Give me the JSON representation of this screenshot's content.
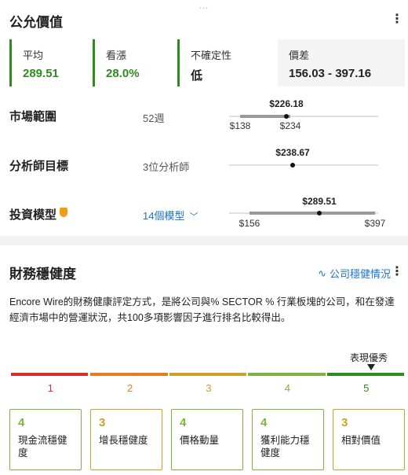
{
  "fair_value": {
    "title": "公允價值",
    "stats": [
      {
        "label": "平均",
        "value": "289.51"
      },
      {
        "label": "看漲",
        "value": "28.0%"
      },
      {
        "label": "不確定性",
        "value": "低"
      },
      {
        "label": "價差",
        "value": "156.03 - 397.16"
      }
    ],
    "rows": [
      {
        "label": "市場範圍",
        "desc": "52週",
        "current": "$226.18",
        "low": "$138",
        "high": "$234"
      },
      {
        "label": "分析師目標",
        "desc": "3位分析師",
        "current": "$238.67"
      },
      {
        "label": "投資模型",
        "desc": "14個模型",
        "current": "$289.51",
        "low": "$156",
        "high": "$397"
      }
    ]
  },
  "financial_health": {
    "title": "財務穩健度",
    "link": "公司穩健情況",
    "description": "Encore Wire的財務健康評定方式，是將公司與% SECTOR % 行業板塊的公司，和在發達經濟市場中的營運狀況，共100多項影響因子進行排名比較得出。",
    "scale_label": "表現優秀",
    "scale": [
      "1",
      "2",
      "3",
      "4",
      "5"
    ],
    "scale_colors": [
      "#d32f2f",
      "#e67e22",
      "#c9a227",
      "#7cb342",
      "#2e8b1d"
    ],
    "scores": [
      {
        "score": "4",
        "name": "現金流穩健度"
      },
      {
        "score": "3",
        "name": "增長穩健度"
      },
      {
        "score": "4",
        "name": "價格動量"
      },
      {
        "score": "4",
        "name": "獲利能力穩健度"
      },
      {
        "score": "3",
        "name": "相對價值"
      }
    ]
  }
}
